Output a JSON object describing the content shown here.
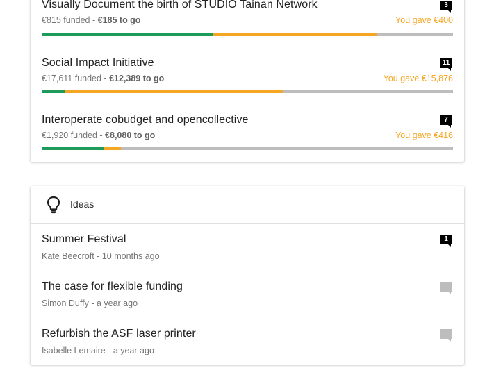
{
  "projects": [
    {
      "title": "Visually Document the birth of STUDIO Tainan Network",
      "funded": "€815 funded - ",
      "to_go": "€185 to go",
      "gave": "You gave €400",
      "comments": "3",
      "funded_fraction": 0.415,
      "gave_fraction": 0.4
    },
    {
      "title": "Social Impact Initiative",
      "funded": "€17,611 funded - ",
      "to_go": "€12,389 to go",
      "gave": "You gave €15,876",
      "comments": "11",
      "funded_fraction": 0.058,
      "gave_fraction": 0.53
    },
    {
      "title": "Interoperate cobudget and opencollective",
      "funded": "€1,920 funded - ",
      "to_go": "€8,080 to go",
      "gave": "You gave €416",
      "comments": "7",
      "funded_fraction": 0.151,
      "gave_fraction": 0.042
    }
  ],
  "ideas": {
    "header": "Ideas",
    "items": [
      {
        "title": "Summer Festival",
        "meta": "Kate Beecroft - 10 months ago",
        "comments": "1"
      },
      {
        "title": "The case for flexible funding",
        "meta": "Simon Duffy - a year ago",
        "comments": ""
      },
      {
        "title": "Refurbish the ASF laser printer",
        "meta": "Isabelle Lemaire - a year ago",
        "comments": ""
      }
    ]
  },
  "colors": {
    "funded": "#1e9b5b",
    "gave": "#f5a623",
    "remaining": "#bdbdbd",
    "badge_active": "#000000",
    "badge_empty": "#bdbdbd"
  }
}
